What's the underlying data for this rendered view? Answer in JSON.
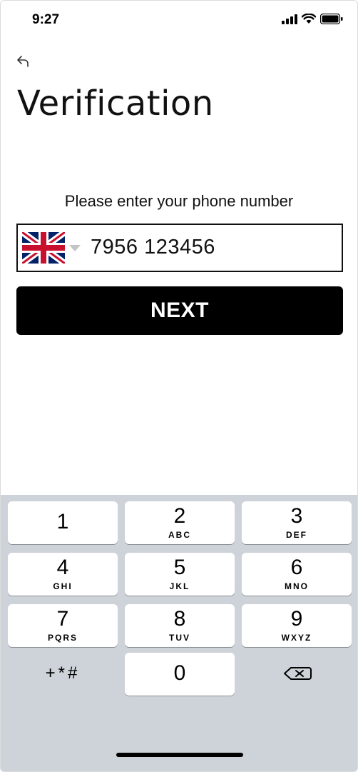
{
  "status_bar": {
    "time": "9:27",
    "icons": [
      "signal-icon",
      "wifi-icon",
      "battery-icon"
    ]
  },
  "header": {
    "back_icon": "back-arrow-icon",
    "title": "Verification"
  },
  "form": {
    "prompt": "Please enter your phone number",
    "country_flag": "uk-flag-icon",
    "phone_value": "7956 123456",
    "next_label": "NEXT"
  },
  "keypad": {
    "keys": [
      {
        "num": "1",
        "letters": ""
      },
      {
        "num": "2",
        "letters": "ABC"
      },
      {
        "num": "3",
        "letters": "DEF"
      },
      {
        "num": "4",
        "letters": "GHI"
      },
      {
        "num": "5",
        "letters": "JKL"
      },
      {
        "num": "6",
        "letters": "MNO"
      },
      {
        "num": "7",
        "letters": "PQRS"
      },
      {
        "num": "8",
        "letters": "TUV"
      },
      {
        "num": "9",
        "letters": "WXYZ"
      },
      {
        "num": "0",
        "letters": ""
      }
    ],
    "symbols": "+*#",
    "delete_icon": "backspace-icon"
  },
  "colors": {
    "button_bg": "#000000",
    "keypad_bg": "#ced3d9",
    "key_bg": "#ffffff"
  }
}
